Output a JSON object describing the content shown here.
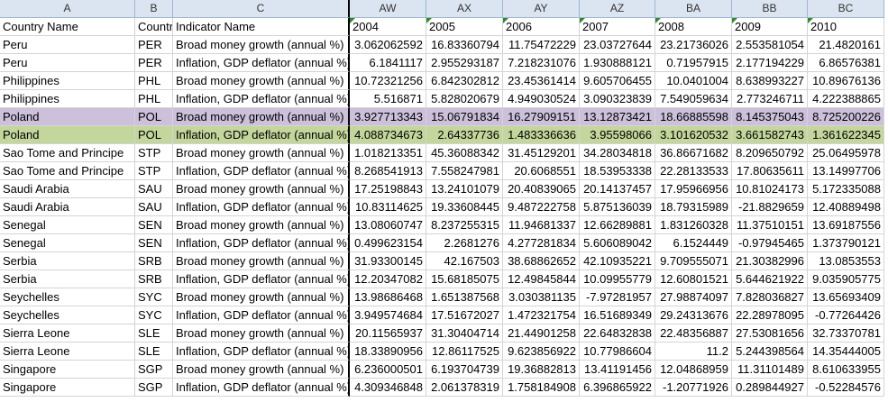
{
  "columns": [
    {
      "letter": "A",
      "width": 150
    },
    {
      "letter": "B",
      "width": 42
    },
    {
      "letter": "C",
      "width": 196
    },
    {
      "letter": "AW",
      "width": 85
    },
    {
      "letter": "AX",
      "width": 85
    },
    {
      "letter": "AY",
      "width": 85
    },
    {
      "letter": "AZ",
      "width": 84
    },
    {
      "letter": "BA",
      "width": 85
    },
    {
      "letter": "BB",
      "width": 84
    },
    {
      "letter": "BC",
      "width": 85
    }
  ],
  "header_row": [
    "Country Name",
    "Country Code",
    "Indicator Name",
    "2004",
    "2005",
    "2006",
    "2007",
    "2008",
    "2009",
    "2010"
  ],
  "rows": [
    {
      "country": "Peru",
      "code": "PER",
      "indicator": "Broad money growth (annual %)",
      "values": [
        "3.062062592",
        "16.83360794",
        "11.75472229",
        "23.03727644",
        "23.21736026",
        "2.553581054",
        "21.4820161"
      ]
    },
    {
      "country": "Peru",
      "code": "PER",
      "indicator": "Inflation, GDP deflator (annual %)",
      "values": [
        "6.1841117",
        "2.955293187",
        "7.218231076",
        "1.930888121",
        "0.71957915",
        "2.177194229",
        "6.86576381"
      ]
    },
    {
      "country": "Philippines",
      "code": "PHL",
      "indicator": "Broad money growth (annual %)",
      "values": [
        "10.72321256",
        "6.842302812",
        "23.45361414",
        "9.605706455",
        "10.0401004",
        "8.638993227",
        "10.89676136"
      ]
    },
    {
      "country": "Philippines",
      "code": "PHL",
      "indicator": "Inflation, GDP deflator (annual %)",
      "values": [
        "5.516871",
        "5.828020679",
        "4.949030524",
        "3.090323839",
        "7.549059634",
        "2.773246711",
        "4.222388865"
      ]
    },
    {
      "country": "Poland",
      "code": "POL",
      "indicator": "Broad money growth (annual %)",
      "values": [
        "3.927713343",
        "15.06791834",
        "16.27909151",
        "13.12873421",
        "18.66885598",
        "8.145375043",
        "8.725200226"
      ],
      "highlight": "purple"
    },
    {
      "country": "Poland",
      "code": "POL",
      "indicator": "Inflation, GDP deflator (annual %)",
      "values": [
        "4.088734673",
        "2.64337736",
        "1.483336636",
        "3.95598066",
        "3.101620532",
        "3.661582743",
        "1.361622345"
      ],
      "highlight": "green"
    },
    {
      "country": "Sao Tome and Principe",
      "code": "STP",
      "indicator": "Broad money growth (annual %)",
      "values": [
        "1.018213351",
        "45.36088342",
        "31.45129201",
        "34.28034818",
        "36.86671682",
        "8.209650792",
        "25.06495978"
      ]
    },
    {
      "country": "Sao Tome and Principe",
      "code": "STP",
      "indicator": "Inflation, GDP deflator (annual %)",
      "values": [
        "8.268541913",
        "7.558247981",
        "20.6068551",
        "18.53953338",
        "22.28133533",
        "17.80635611",
        "13.14997706"
      ]
    },
    {
      "country": "Saudi Arabia",
      "code": "SAU",
      "indicator": "Broad money growth (annual %)",
      "values": [
        "17.25198843",
        "13.24101079",
        "20.40839065",
        "20.14137457",
        "17.95966956",
        "10.81024173",
        "5.172335088"
      ]
    },
    {
      "country": "Saudi Arabia",
      "code": "SAU",
      "indicator": "Inflation, GDP deflator (annual %)",
      "values": [
        "10.83114625",
        "19.33608445",
        "9.487222758",
        "5.875136039",
        "18.79315989",
        "-21.8829659",
        "12.40889498"
      ]
    },
    {
      "country": "Senegal",
      "code": "SEN",
      "indicator": "Broad money growth (annual %)",
      "values": [
        "13.08060747",
        "8.237255315",
        "11.94681337",
        "12.66289881",
        "1.831260328",
        "11.37510151",
        "13.69187556"
      ]
    },
    {
      "country": "Senegal",
      "code": "SEN",
      "indicator": "Inflation, GDP deflator (annual %)",
      "values": [
        "0.499623154",
        "2.2681276",
        "4.277281834",
        "5.606089042",
        "6.1524449",
        "-0.97945465",
        "1.373790121"
      ]
    },
    {
      "country": "Serbia",
      "code": "SRB",
      "indicator": "Broad money growth (annual %)",
      "values": [
        "31.93300145",
        "42.167503",
        "38.68862652",
        "42.10935221",
        "9.709555071",
        "21.30382996",
        "13.0853553"
      ]
    },
    {
      "country": "Serbia",
      "code": "SRB",
      "indicator": "Inflation, GDP deflator (annual %)",
      "values": [
        "12.20347082",
        "15.68185075",
        "12.49845844",
        "10.09955779",
        "12.60801521",
        "5.644621922",
        "9.035905775"
      ]
    },
    {
      "country": "Seychelles",
      "code": "SYC",
      "indicator": "Broad money growth (annual %)",
      "values": [
        "13.98686468",
        "1.651387568",
        "3.030381135",
        "-7.97281957",
        "27.98874097",
        "7.828036827",
        "13.65693409"
      ]
    },
    {
      "country": "Seychelles",
      "code": "SYC",
      "indicator": "Inflation, GDP deflator (annual %)",
      "values": [
        "3.949574684",
        "17.51672027",
        "1.472321754",
        "16.51689349",
        "29.24313676",
        "22.28978095",
        "-0.77264426"
      ]
    },
    {
      "country": "Sierra Leone",
      "code": "SLE",
      "indicator": "Broad money growth (annual %)",
      "values": [
        "20.11565937",
        "31.30404714",
        "21.44901258",
        "22.64832838",
        "22.48356887",
        "27.53081656",
        "32.73370781"
      ]
    },
    {
      "country": "Sierra Leone",
      "code": "SLE",
      "indicator": "Inflation, GDP deflator (annual %)",
      "values": [
        "18.33890956",
        "12.86117525",
        "9.623856922",
        "10.77986604",
        "11.2",
        "5.244398564",
        "14.35444005"
      ]
    },
    {
      "country": "Singapore",
      "code": "SGP",
      "indicator": "Broad money growth (annual %)",
      "values": [
        "6.236000501",
        "6.193704739",
        "19.36882813",
        "13.41191456",
        "12.04868959",
        "11.31101489",
        "8.610633955"
      ]
    },
    {
      "country": "Singapore",
      "code": "SGP",
      "indicator": "Inflation, GDP deflator (annual %)",
      "values": [
        "4.309346848",
        "2.061378319",
        "1.758184908",
        "6.396865922",
        "-1.20771926",
        "0.289844927",
        "-0.52284576"
      ]
    }
  ],
  "colors": {
    "header_bg": "#dbe5f1",
    "selected_purple": "#ccc0da",
    "selected_green": "#c3d69b",
    "gridline": "#d4d4d4",
    "marker_green": "#2d8a2d"
  }
}
